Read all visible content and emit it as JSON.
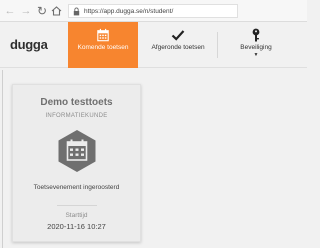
{
  "browser": {
    "url": "https://app.dugga.se/n/student/",
    "icons": [
      "back-arrow-icon",
      "forward-arrow-icon",
      "reload-icon",
      "home-icon",
      "lock-icon"
    ]
  },
  "header": {
    "logo": "dugga",
    "tabs": [
      {
        "label": "Komende toetsen",
        "icon": "calendar-icon",
        "active": true
      },
      {
        "label": "Afgeronde toetsen",
        "icon": "checkmark-icon",
        "active": false
      },
      {
        "label": "Beveiliging",
        "icon": "key-icon",
        "active": false,
        "has_dropdown": true
      }
    ],
    "accent_color": "#f7852f"
  },
  "card": {
    "title": "Demo testtoets",
    "subject": "INFORMATIEKUNDE",
    "icon": "calendar-icon",
    "status": "Toetsevenement ingeroosterd",
    "start_label": "Starttijd",
    "start_value": "2020-11-16 10:27",
    "hex_color": "#6f6f6f"
  }
}
